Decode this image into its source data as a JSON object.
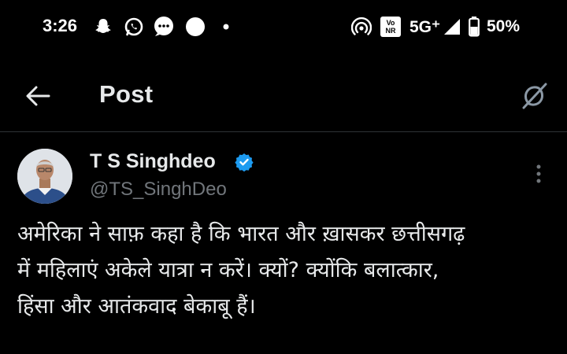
{
  "status_bar": {
    "time": "3:26",
    "network": "5G⁺",
    "volte": "Vo NR",
    "battery": "50%",
    "notification_icons": [
      "snapchat-icon",
      "whatsapp-icon",
      "messages-icon",
      "circle-icon",
      "dot-icon"
    ],
    "system_icons": [
      "hotspot-icon",
      "volte-icon",
      "signal-icon",
      "battery-icon"
    ]
  },
  "header": {
    "title": "Post",
    "back_icon": "arrow-left-icon",
    "grok_icon": "grok-icon"
  },
  "post": {
    "author_name": "T S Singhdeo",
    "handle": "@TS_SinghDeo",
    "verified": true,
    "text_lines": [
      "अमेरिका ने साफ़ कहा है कि भारत और ख़ासकर छत्तीसगढ़",
      "में महिलाएं अकेले यात्रा न करें। क्यों? क्योंकि बलात्कार,",
      "हिंसा और आतंकवाद बेकाबू हैं।"
    ]
  },
  "colors": {
    "background": "#000000",
    "text_primary": "#e7e9ea",
    "text_secondary": "#71767b",
    "verified_blue": "#1d9bf0",
    "divider": "#2f3336"
  }
}
